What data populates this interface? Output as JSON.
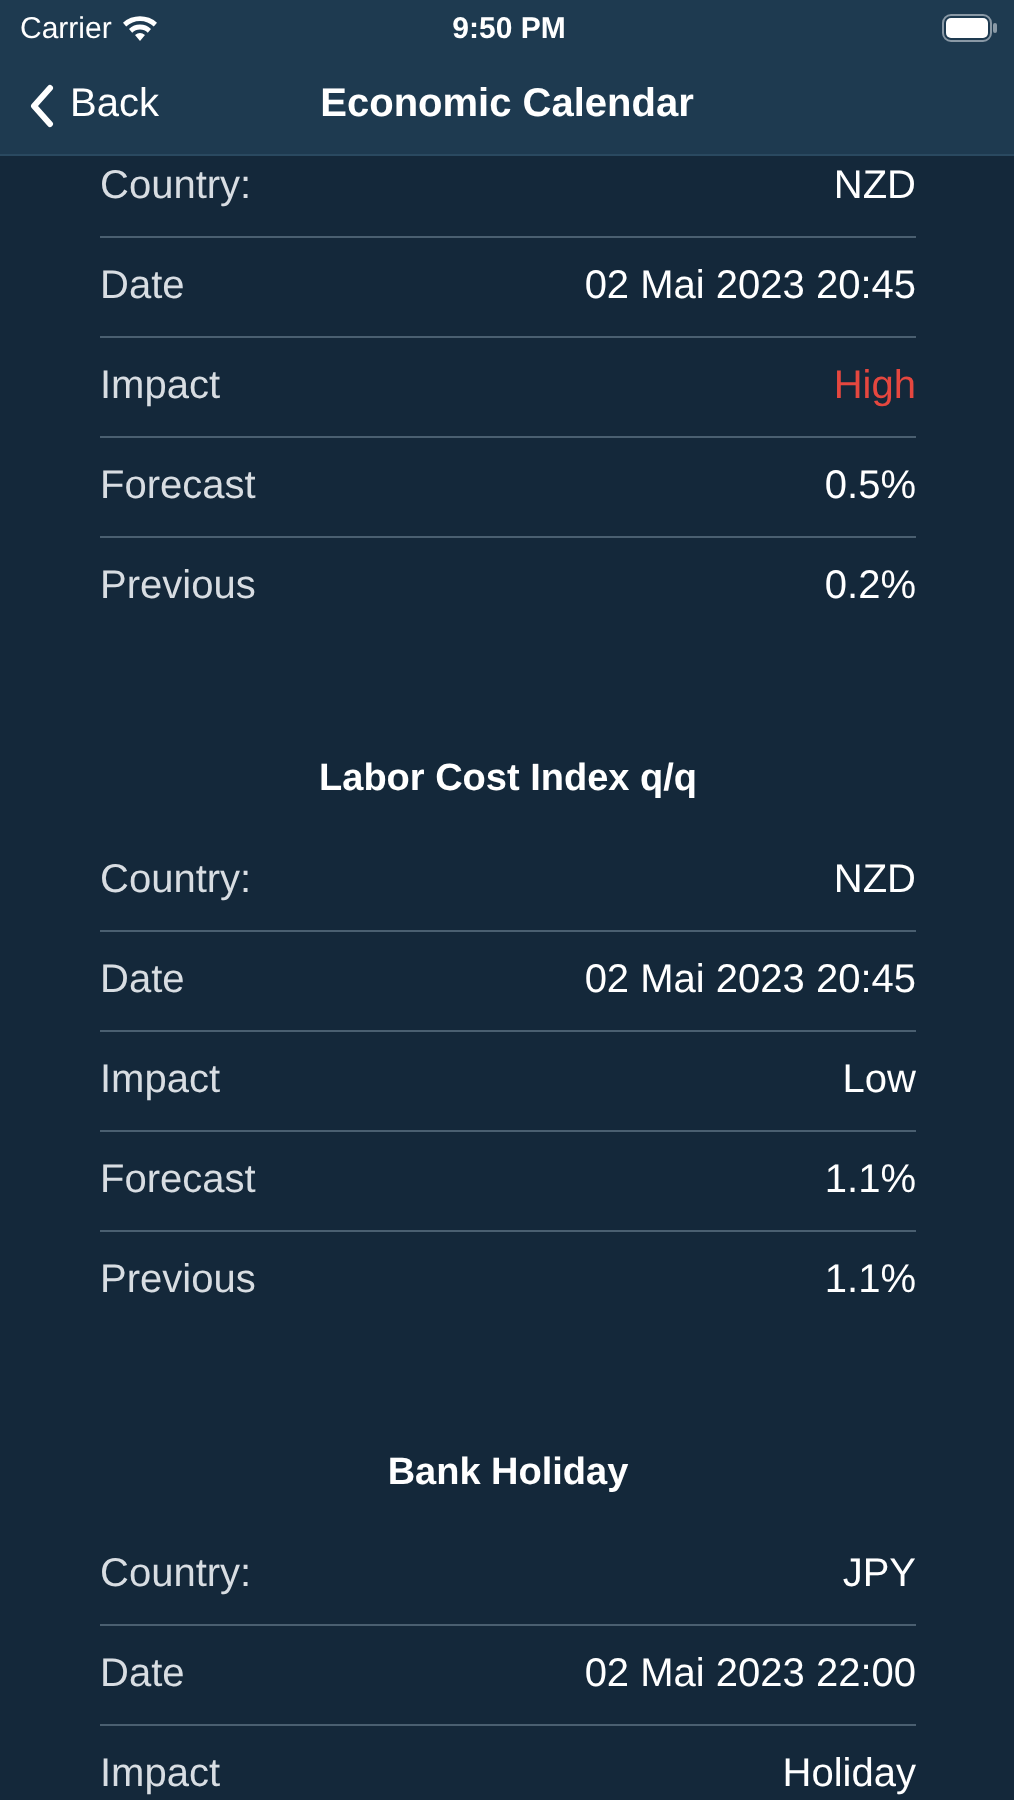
{
  "status_bar": {
    "carrier": "Carrier",
    "time": "9:50 PM"
  },
  "nav": {
    "back": "Back",
    "title": "Economic Calendar"
  },
  "sections": [
    {
      "rows": [
        {
          "label": "Country:",
          "value": "NZD",
          "color": "#ffffff"
        },
        {
          "label": "Date",
          "value": "02 Mai 2023 20:45",
          "color": "#ffffff"
        },
        {
          "label": "Impact",
          "value": "High",
          "color": "#e5473f"
        },
        {
          "label": "Forecast",
          "value": "0.5%",
          "color": "#ffffff"
        },
        {
          "label": "Previous",
          "value": "0.2%",
          "color": "#ffffff"
        }
      ]
    },
    {
      "title": "Labor Cost Index q/q",
      "rows": [
        {
          "label": "Country:",
          "value": "NZD",
          "color": "#ffffff"
        },
        {
          "label": "Date",
          "value": "02 Mai 2023 20:45",
          "color": "#ffffff"
        },
        {
          "label": "Impact",
          "value": "Low",
          "color": "#ffffff"
        },
        {
          "label": "Forecast",
          "value": "1.1%",
          "color": "#ffffff"
        },
        {
          "label": "Previous",
          "value": "1.1%",
          "color": "#ffffff"
        }
      ]
    },
    {
      "title": "Bank Holiday",
      "rows": [
        {
          "label": "Country:",
          "value": "JPY",
          "color": "#ffffff"
        },
        {
          "label": "Date",
          "value": "02 Mai 2023 22:00",
          "color": "#ffffff"
        },
        {
          "label": "Impact",
          "value": "Holiday",
          "color": "#ffffff"
        }
      ]
    }
  ]
}
